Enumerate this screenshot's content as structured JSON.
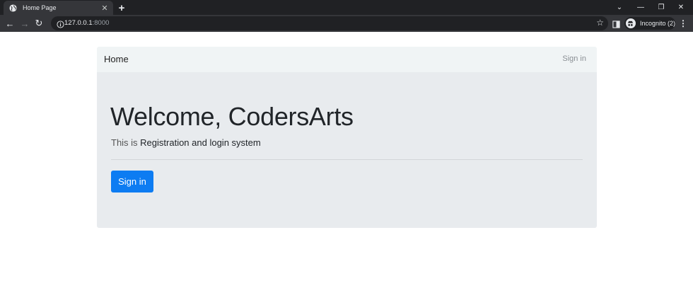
{
  "browser": {
    "tab_title": "Home Page",
    "tab_close_glyph": "✕",
    "new_tab_glyph": "+",
    "url_host": "127.0.0.1",
    "url_port": ":8000",
    "star_glyph": "☆",
    "incognito_label": "Incognito (2)",
    "menu_glyph": "⋮",
    "back_glyph": "←",
    "forward_glyph": "→",
    "reload_glyph": "↻",
    "dropdown_glyph": "⌄",
    "minimize_glyph": "—",
    "restore_glyph": "❐",
    "close_glyph": "✕",
    "icons": {
      "favicon": "globe-icon",
      "info": "info-icon",
      "side_panel": "side-panel-icon",
      "incognito_avatar": "incognito-icon"
    },
    "colors": {
      "tabstrip": "#202124",
      "toolbar": "#35363a",
      "omnibox": "#202124"
    }
  },
  "navbar": {
    "brand": "Home",
    "signin_link": "Sign in"
  },
  "jumbotron": {
    "heading": "Welcome, CodersArts",
    "lead_prefix": "This is ",
    "lead_main": "Registration and login system",
    "button_label": "Sign in",
    "colors": {
      "button": "#0d7cf2",
      "background": "#e8ebee"
    }
  }
}
